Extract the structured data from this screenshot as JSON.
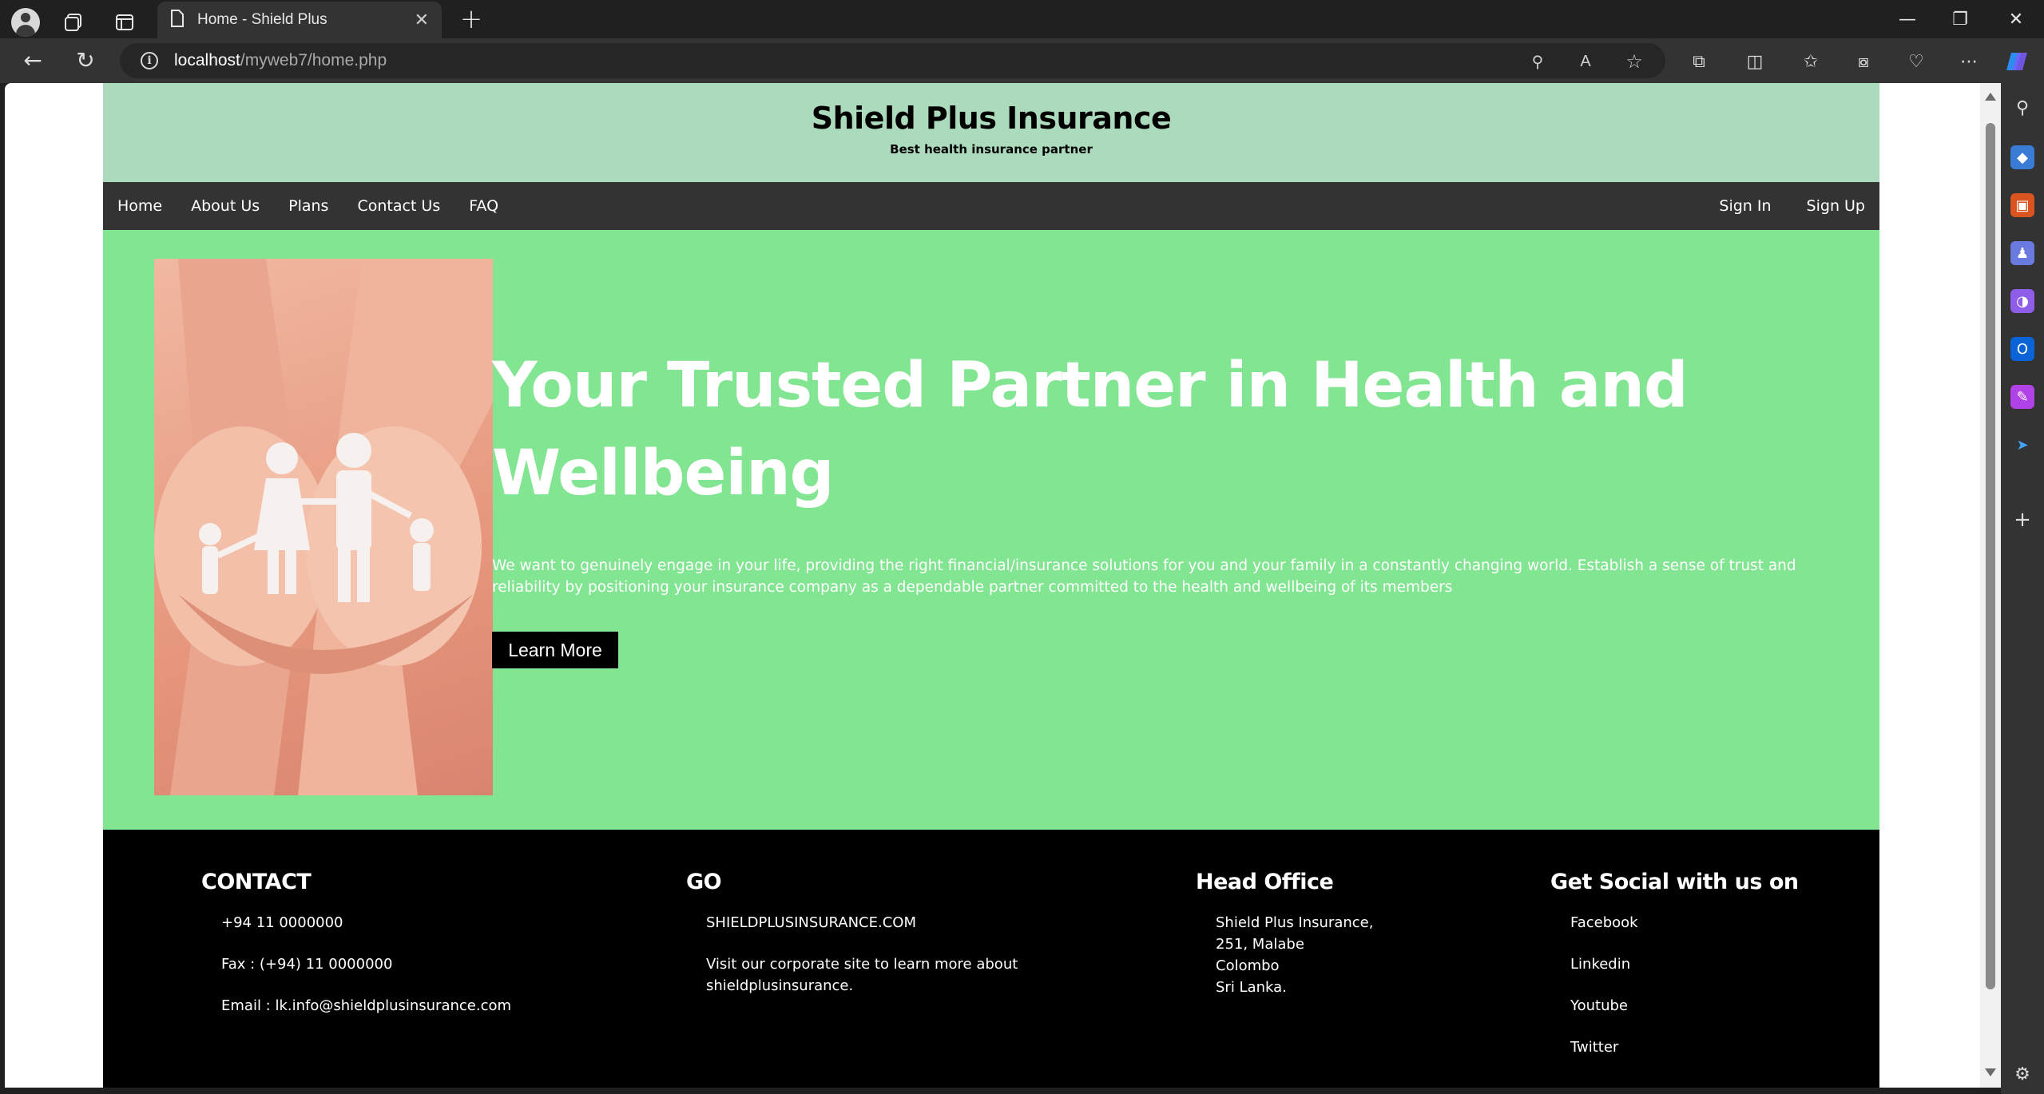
{
  "browser": {
    "tab_title": "Home - Shield Plus",
    "url_host": "localhost",
    "url_path": "/myweb7/home.php",
    "icons": [
      "profile-icon",
      "workspaces-icon",
      "tab-actions-icon",
      "page-icon",
      "close-icon",
      "plus-icon",
      "minimize-icon",
      "restore-icon",
      "window-close-icon",
      "back-icon",
      "refresh-icon",
      "info-icon",
      "zoom-icon",
      "read-aloud-icon",
      "favorite-star-icon",
      "extensions-icon",
      "split-screen-icon",
      "favorites-icon",
      "collections-icon",
      "browser-essentials-icon",
      "more-icon",
      "copilot-icon"
    ]
  },
  "site": {
    "header": {
      "title": "Shield Plus Insurance",
      "tagline": "Best health insurance partner"
    },
    "nav": {
      "left": [
        "Home",
        "About Us",
        "Plans",
        "Contact Us",
        "FAQ"
      ],
      "right": [
        "Sign In",
        "Sign Up"
      ]
    },
    "hero": {
      "heading": "Your Trusted Partner in Health and Wellbeing",
      "text": "We want to genuinely engage in your life, providing the right financial/insurance solutions for you and your family in a constantly changing world. Establish a sense of trust and reliability by positioning your insurance company as a dependable partner committed to the health and wellbeing of its members",
      "button": "Learn More"
    },
    "footer": {
      "contact": {
        "heading": "CONTACT",
        "items": [
          "+94 11 0000000",
          "Fax : (+94) 11 0000000",
          "Email : lk.info@shieldplusinsurance.com"
        ]
      },
      "go": {
        "heading": "GO",
        "items": [
          "SHIELDPLUSINSURANCE.COM",
          "Visit our corporate site to learn more about shieldplusinsurance."
        ]
      },
      "head_office": {
        "heading": "Head Office",
        "lines": [
          "Shield Plus Insurance,",
          "251, Malabe",
          "Colombo",
          "Sri Lanka."
        ]
      },
      "social": {
        "heading": "Get Social with us on",
        "items": [
          "Facebook",
          "Linkedin",
          "Youtube",
          "Twitter"
        ]
      }
    }
  },
  "colors": {
    "header_bg": "#acdabc",
    "nav_bg": "#333333",
    "hero_bg": "#82e591",
    "footer_bg": "#000000"
  }
}
